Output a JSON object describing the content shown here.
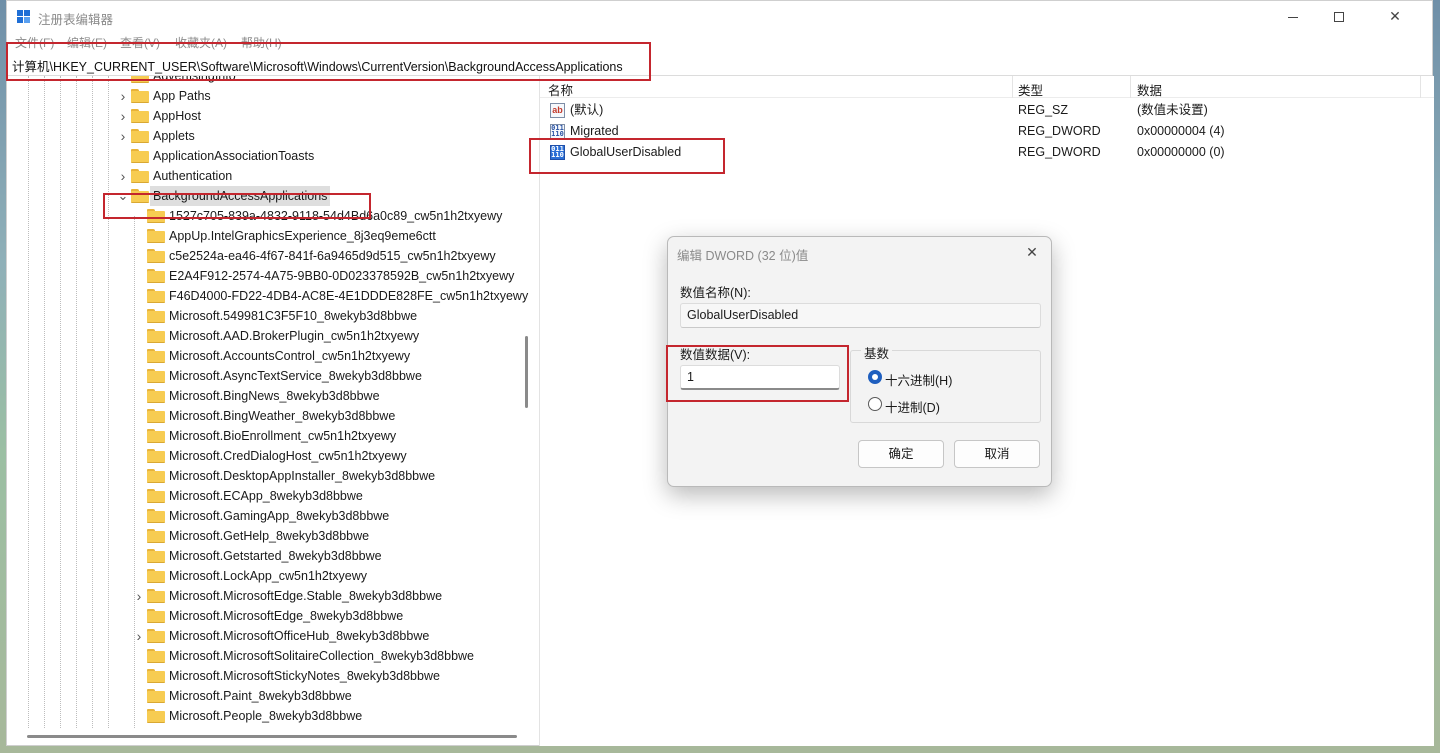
{
  "window": {
    "title": "注册表编辑器",
    "controls": {
      "minimize": "minimize",
      "maximize": "maximize",
      "close": "✕"
    }
  },
  "menu": [
    {
      "label": "文件(F)"
    },
    {
      "label": "编辑(E)"
    },
    {
      "label": "查看(V)"
    },
    {
      "label": "收藏夹(A)"
    },
    {
      "label": "帮助(H)"
    }
  ],
  "address": "计算机\\HKEY_CURRENT_USER\\Software\\Microsoft\\Windows\\CurrentVersion\\BackgroundAccessApplications",
  "tree": {
    "parent_keys": [
      {
        "label": "AdvertisingInfo",
        "expandable": false
      },
      {
        "label": "App Paths",
        "expandable": true
      },
      {
        "label": "AppHost",
        "expandable": true
      },
      {
        "label": "Applets",
        "expandable": true
      },
      {
        "label": "ApplicationAssociationToasts",
        "expandable": false
      },
      {
        "label": "Authentication",
        "expandable": true
      },
      {
        "label": "BackgroundAccessApplications",
        "expandable": true,
        "expanded": true,
        "selected": true
      }
    ],
    "child_keys": [
      {
        "label": "1527c705-839a-4832-9118-54d4Bd6a0c89_cw5n1h2txyewy",
        "expandable": false
      },
      {
        "label": "AppUp.IntelGraphicsExperience_8j3eq9eme6ctt",
        "expandable": false
      },
      {
        "label": "c5e2524a-ea46-4f67-841f-6a9465d9d515_cw5n1h2txyewy",
        "expandable": false
      },
      {
        "label": "E2A4F912-2574-4A75-9BB0-0D023378592B_cw5n1h2txyewy",
        "expandable": false
      },
      {
        "label": "F46D4000-FD22-4DB4-AC8E-4E1DDDE828FE_cw5n1h2txyewy",
        "expandable": false
      },
      {
        "label": "Microsoft.549981C3F5F10_8wekyb3d8bbwe",
        "expandable": false
      },
      {
        "label": "Microsoft.AAD.BrokerPlugin_cw5n1h2txyewy",
        "expandable": false
      },
      {
        "label": "Microsoft.AccountsControl_cw5n1h2txyewy",
        "expandable": false
      },
      {
        "label": "Microsoft.AsyncTextService_8wekyb3d8bbwe",
        "expandable": false
      },
      {
        "label": "Microsoft.BingNews_8wekyb3d8bbwe",
        "expandable": false
      },
      {
        "label": "Microsoft.BingWeather_8wekyb3d8bbwe",
        "expandable": false
      },
      {
        "label": "Microsoft.BioEnrollment_cw5n1h2txyewy",
        "expandable": false
      },
      {
        "label": "Microsoft.CredDialogHost_cw5n1h2txyewy",
        "expandable": false
      },
      {
        "label": "Microsoft.DesktopAppInstaller_8wekyb3d8bbwe",
        "expandable": false
      },
      {
        "label": "Microsoft.ECApp_8wekyb3d8bbwe",
        "expandable": false
      },
      {
        "label": "Microsoft.GamingApp_8wekyb3d8bbwe",
        "expandable": false
      },
      {
        "label": "Microsoft.GetHelp_8wekyb3d8bbwe",
        "expandable": false
      },
      {
        "label": "Microsoft.Getstarted_8wekyb3d8bbwe",
        "expandable": false
      },
      {
        "label": "Microsoft.LockApp_cw5n1h2txyewy",
        "expandable": false
      },
      {
        "label": "Microsoft.MicrosoftEdge.Stable_8wekyb3d8bbwe",
        "expandable": true
      },
      {
        "label": "Microsoft.MicrosoftEdge_8wekyb3d8bbwe",
        "expandable": false
      },
      {
        "label": "Microsoft.MicrosoftOfficeHub_8wekyb3d8bbwe",
        "expandable": true
      },
      {
        "label": "Microsoft.MicrosoftSolitaireCollection_8wekyb3d8bbwe",
        "expandable": false
      },
      {
        "label": "Microsoft.MicrosoftStickyNotes_8wekyb3d8bbwe",
        "expandable": false
      },
      {
        "label": "Microsoft.Paint_8wekyb3d8bbwe",
        "expandable": false
      },
      {
        "label": "Microsoft.People_8wekyb3d8bbwe",
        "expandable": false
      }
    ]
  },
  "values": {
    "columns": {
      "name": "名称",
      "type": "类型",
      "data": "数据"
    },
    "rows": [
      {
        "name": "(默认)",
        "type": "REG_SZ",
        "data": "(数值未设置)",
        "icon": "string-value-icon"
      },
      {
        "name": "Migrated",
        "type": "REG_DWORD",
        "data": "0x00000004 (4)",
        "icon": "binary-value-icon"
      },
      {
        "name": "GlobalUserDisabled",
        "type": "REG_DWORD",
        "data": "0x00000000 (0)",
        "icon": "binary-value-icon"
      }
    ]
  },
  "dialog": {
    "title": "编辑 DWORD (32 位)值",
    "close": "✕",
    "name_label": "数值名称(N):",
    "name_value": "GlobalUserDisabled",
    "data_label": "数值数据(V):",
    "data_value": "1",
    "base_label": "基数",
    "base_options": [
      {
        "label": "十六进制(H)",
        "checked": true
      },
      {
        "label": "十进制(D)",
        "checked": false
      }
    ],
    "ok": "确定",
    "cancel": "取消"
  },
  "colors": {
    "highlight_box": "#c4262e",
    "folder": "#f7cc52",
    "radio_accent": "#1f5fbf"
  }
}
